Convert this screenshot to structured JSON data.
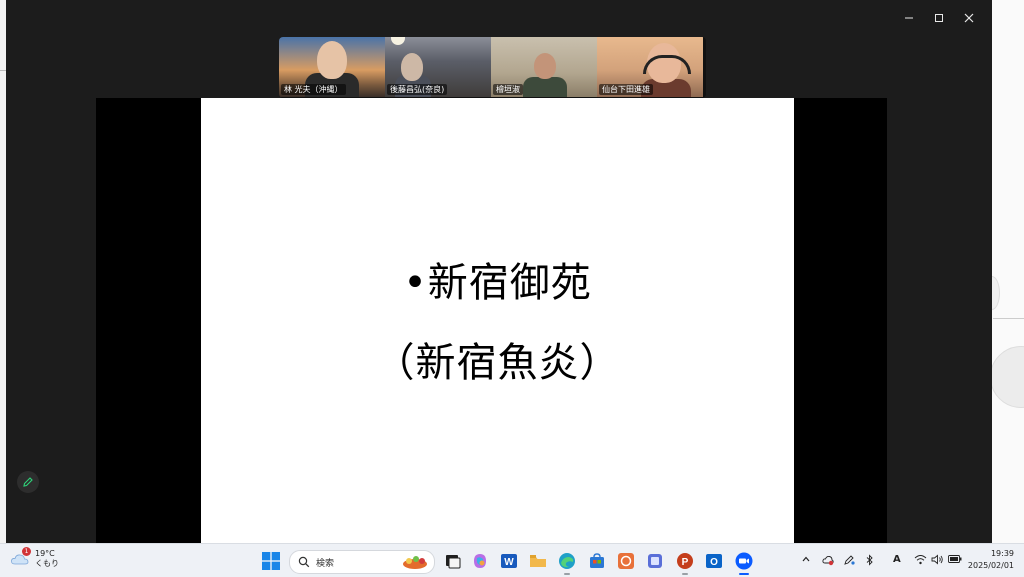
{
  "window": {
    "controls": [
      "minimize",
      "maximize",
      "close"
    ]
  },
  "participants": [
    {
      "name": "林 光夫（沖縄）",
      "active": false
    },
    {
      "name": "後藤昌弘(奈良)",
      "active": false
    },
    {
      "name": "檜垣淑",
      "active": true
    },
    {
      "name": "仙台下田進雄",
      "active": false
    }
  ],
  "slide": {
    "line1": "•新宿御苑",
    "line2": "（新宿魚炎）"
  },
  "taskbar": {
    "weather": {
      "temp": "19°C",
      "condition": "くもり",
      "badge": "1"
    },
    "search_label": "検索",
    "clock": {
      "time": "19:39",
      "date": "2025/02/01"
    },
    "ime_label": "A",
    "colors": {
      "word": "#185abd",
      "powerpoint": "#c43e1c",
      "outlook": "#0a64c8",
      "zoom": "#0b5cff",
      "explorer": "#f2b84b"
    }
  }
}
